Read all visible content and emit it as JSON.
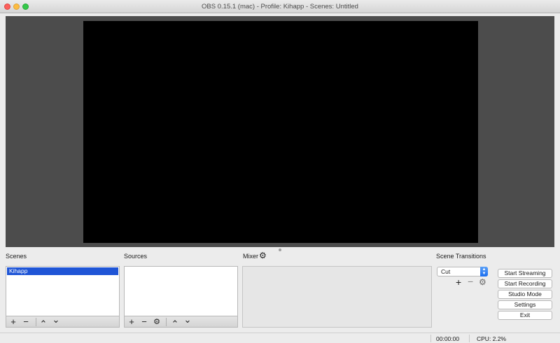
{
  "window": {
    "title": "OBS 0.15.1 (mac) - Profile: Kihapp - Scenes: Untitled"
  },
  "docks": {
    "scenes": {
      "label": "Scenes",
      "items": [
        "Kihapp"
      ]
    },
    "sources": {
      "label": "Sources",
      "items": []
    },
    "mixer": {
      "label": "Mixer"
    },
    "transitions": {
      "label": "Scene Transitions",
      "selected": "Cut"
    }
  },
  "controls": {
    "start_streaming": "Start Streaming",
    "start_recording": "Start Recording",
    "studio_mode": "Studio Mode",
    "settings": "Settings",
    "exit": "Exit"
  },
  "toolbar_glyphs": {
    "add": "+",
    "remove": "−",
    "up": "⌃",
    "down": "⌄",
    "gear": "⚙"
  },
  "status": {
    "time": "00:00:00",
    "cpu": "CPU: 2.2%"
  }
}
